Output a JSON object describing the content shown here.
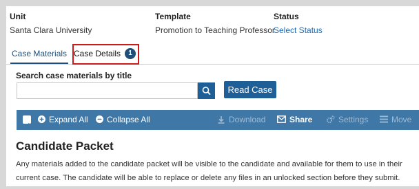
{
  "header": {
    "unit_label": "Unit",
    "unit_value": "Santa Clara University",
    "template_label": "Template",
    "template_value": "Promotion to Teaching Professor",
    "status_label": "Status",
    "status_value": "Select Status"
  },
  "tabs": [
    {
      "label": "Case Materials",
      "active": true
    },
    {
      "label": "Case Details",
      "badge": "1",
      "active": false
    }
  ],
  "search": {
    "label": "Search case materials by title",
    "placeholder": "",
    "read_case_label": "Read Case"
  },
  "toolbar": {
    "expand_all": "Expand All",
    "collapse_all": "Collapse All",
    "download": "Download",
    "share": "Share",
    "settings": "Settings",
    "move": "Move"
  },
  "candidate_packet": {
    "title": "Candidate Packet",
    "description": "Any materials added to the candidate packet will be visible to the candidate and available for them to use in their current case. The candidate will be able to replace or delete any files in an unlocked section before they submit."
  },
  "colors": {
    "toolbar": "#3f78a7",
    "button": "#1f5f97",
    "highlight": "#cc1b1b",
    "link": "#1f6bb5"
  }
}
